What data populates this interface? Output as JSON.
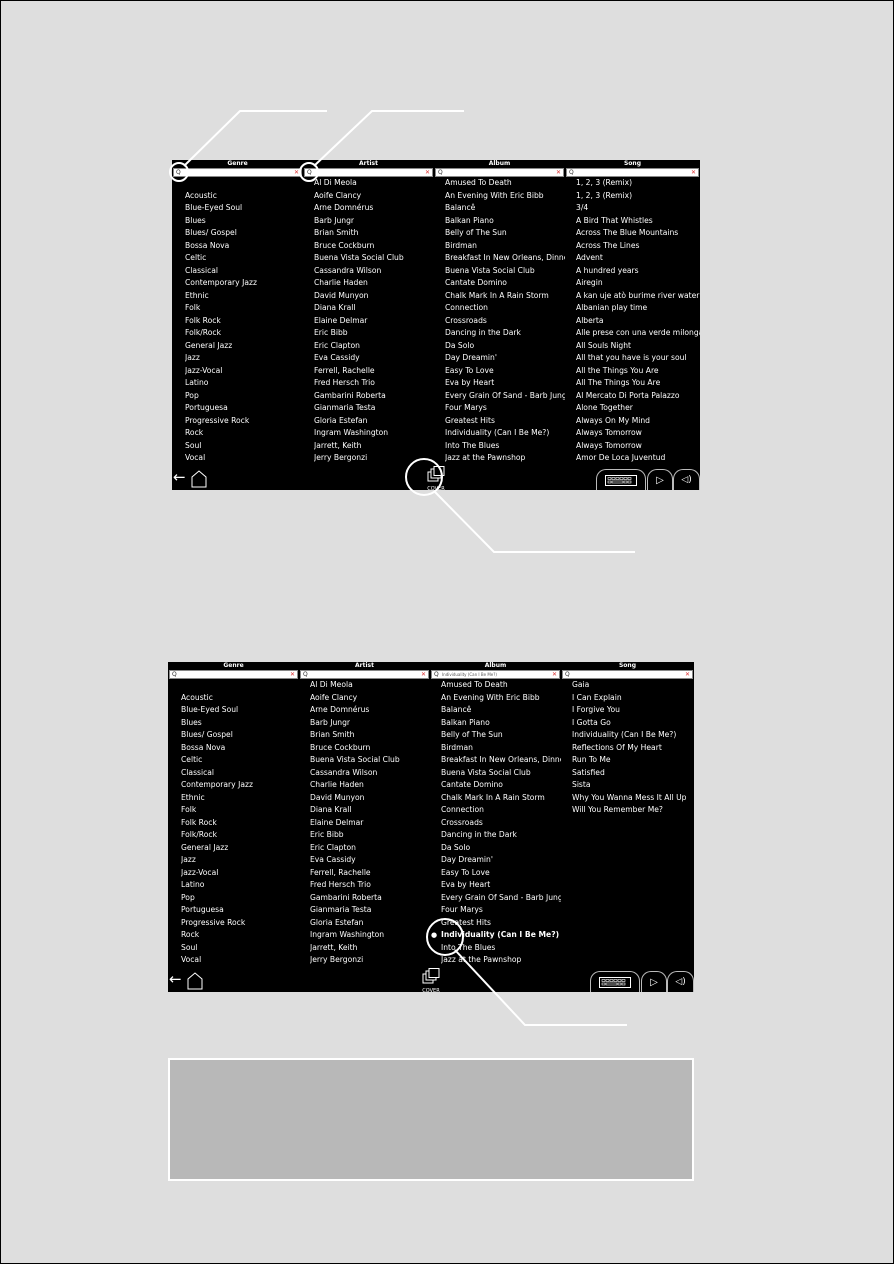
{
  "screens": [
    {
      "columns": [
        {
          "header": "Genre",
          "search_value": "",
          "items": [
            "",
            "Acoustic",
            "Blue-Eyed Soul",
            "Blues",
            "Blues/ Gospel",
            "Bossa Nova",
            "Celtic",
            "Classical",
            "Contemporary Jazz",
            "Ethnic",
            "Folk",
            "Folk Rock",
            "Folk/Rock",
            "General Jazz",
            "Jazz",
            "Jazz-Vocal",
            "Latino",
            "Pop",
            "Portuguesa",
            "Progressive Rock",
            "Rock",
            "Soul",
            "Vocal"
          ]
        },
        {
          "header": "Artist",
          "search_value": "",
          "items": [
            "Al Di Meola",
            "Aoife Clancy",
            "Arne Domnérus",
            "Barb Jungr",
            "Brian Smith",
            "Bruce Cockburn",
            "Buena Vista Social Club",
            "Cassandra Wilson",
            "Charlie Haden",
            "David Munyon",
            "Diana Krall",
            "Elaine Delmar",
            "Eric Bibb",
            "Eric Clapton",
            "Eva Cassidy",
            "Ferrell, Rachelle",
            "Fred Hersch Trio",
            " Gambarini Roberta",
            "Gianmaria Testa",
            "Gloria Estefan",
            "Ingram Washington",
            "Jarrett, Keith",
            "Jerry Bergonzi"
          ]
        },
        {
          "header": "Album",
          "search_value": "",
          "items": [
            "Amused To Death",
            "An Evening With Eric Bibb",
            "Balancê",
            "Balkan Piano",
            "Belly of The Sun",
            "Birdman",
            "Breakfast In New Orleans, Dinner",
            "Buena Vista Social Club",
            "Cantate Domino",
            "Chalk Mark In A Rain Storm",
            "Connection",
            "Crossroads",
            "Dancing in the Dark",
            "Da Solo",
            "Day Dreamin'",
            "Easy To Love",
            "Eva by Heart",
            "Every Grain Of Sand - Barb Jungr",
            "Four Marys",
            "Greatest Hits",
            "Individuality (Can I Be Me?)",
            "Into The Blues",
            "Jazz at the Pawnshop"
          ]
        },
        {
          "header": "Song",
          "search_value": "",
          "items": [
            "1, 2, 3 (Remix)",
            "1, 2, 3 (Remix)",
            "3/4",
            "A Bird That Whistles",
            "Across The Blue Mountains",
            "Across The Lines",
            "Advent",
            "A hundred years",
            "Airegin",
            "A kan uje atò burime river water",
            "Albanian play time",
            "Alberta",
            "Alle prese con una verde milonga",
            "All Souls Night",
            "All that you have is your soul",
            "All the Things You Are",
            "All The Things You Are",
            "Al Mercato Di Porta Palazzo",
            "Alone Together",
            "Always On My Mind",
            "Always Tomorrow",
            "Always Tomorrow",
            "Amor De Loca Juventud"
          ]
        }
      ],
      "bottom": {
        "cover_label": "COVER"
      }
    },
    {
      "columns": [
        {
          "header": "Genre",
          "search_value": "",
          "items": [
            "",
            "Acoustic",
            "Blue-Eyed Soul",
            "Blues",
            "Blues/ Gospel",
            "Bossa Nova",
            "Celtic",
            "Classical",
            "Contemporary Jazz",
            "Ethnic",
            "Folk",
            "Folk Rock",
            "Folk/Rock",
            "General Jazz",
            "Jazz",
            "Jazz-Vocal",
            "Latino",
            "Pop",
            "Portuguesa",
            "Progressive Rock",
            "Rock",
            "Soul",
            "Vocal"
          ]
        },
        {
          "header": "Artist",
          "search_value": "",
          "items": [
            "Al Di Meola",
            "Aoife Clancy",
            "Arne Domnérus",
            "Barb Jungr",
            "Brian Smith",
            "Bruce Cockburn",
            "Buena Vista Social Club",
            "Cassandra Wilson",
            "Charlie Haden",
            "David Munyon",
            "Diana Krall",
            "Elaine Delmar",
            "Eric Bibb",
            "Eric Clapton",
            "Eva Cassidy",
            "Ferrell, Rachelle",
            "Fred Hersch Trio",
            " Gambarini Roberta",
            "Gianmaria Testa",
            "Gloria Estefan",
            "Ingram Washington",
            "Jarrett, Keith",
            "Jerry Bergonzi"
          ]
        },
        {
          "header": "Album",
          "search_value": "Individuality (Can I Be Me?)",
          "selected_index": 20,
          "items": [
            "Amused To Death",
            "An Evening With Eric Bibb",
            "Balancê",
            "Balkan Piano",
            "Belly of The Sun",
            "Birdman",
            "Breakfast In New Orleans, Dinner",
            "Buena Vista Social Club",
            "Cantate Domino",
            "Chalk Mark In A Rain Storm",
            "Connection",
            "Crossroads",
            "Dancing in the Dark",
            "Da Solo",
            "Day Dreamin'",
            "Easy To Love",
            "Eva by Heart",
            "Every Grain Of Sand - Barb Jungr",
            "Four Marys",
            "Greatest Hits",
            "Individuality (Can I Be Me?)",
            "Into The Blues",
            "Jazz at the Pawnshop"
          ]
        },
        {
          "header": "Song",
          "search_value": "",
          "items": [
            "Gaia",
            "I Can Explain",
            "I Forgive You",
            "I Gotta Go",
            "Individuality (Can I Be Me?)",
            "Reflections Of My Heart",
            "Run To Me",
            "Satisfied",
            "Sista",
            "Why You Wanna Mess It All Up",
            "Will You Remember Me?"
          ]
        }
      ],
      "bottom": {
        "cover_label": "COVER"
      }
    }
  ],
  "icons": {
    "search": "Q",
    "clear": "✕",
    "back": "←",
    "play": "▷",
    "volume": "🔊"
  },
  "colors": {
    "clear_x": "#dd3333",
    "page_bg": "#dedede",
    "note_box": "#b8b8b8"
  }
}
